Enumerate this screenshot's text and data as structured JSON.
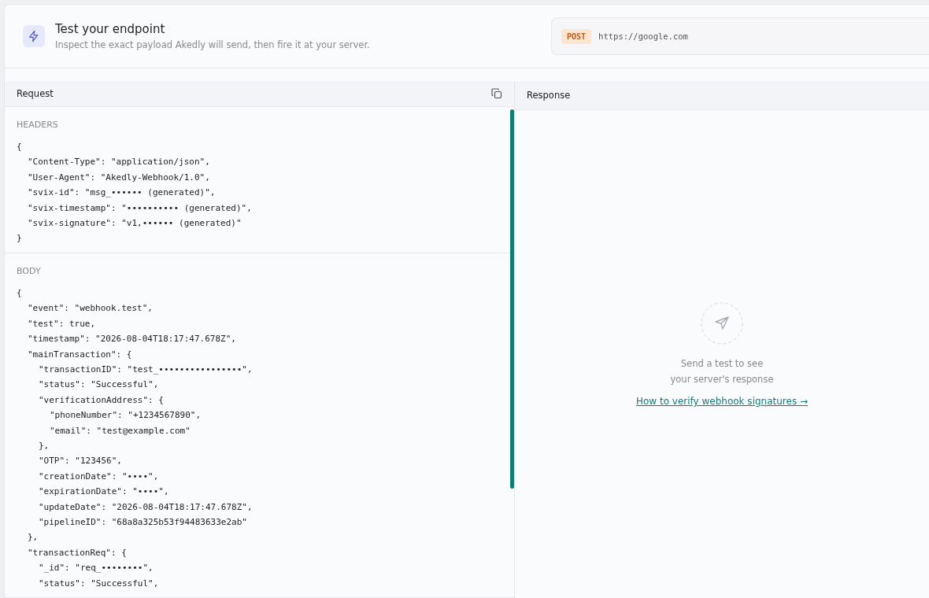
{
  "dialog": {
    "title": "Test your endpoint",
    "subtitle": "Inspect the exact payload Akedly will send, then fire it at your server.",
    "method": "POST",
    "url": "https://google.com"
  },
  "request": {
    "title": "Request",
    "sections": [
      {
        "label": "HEADERS",
        "lines": [
          {
            "text": "{",
            "children": [
              {
                "text": "\"Content-Type\": \"application/json\","
              },
              {
                "text": "\"User-Agent\": \"Akedly-Webhook/1.0\","
              },
              {
                "text": "\"svix-id\": \"msg_•••••• (generated)\","
              },
              {
                "text": "\"svix-timestamp\": \"•••••••••• (generated)\","
              },
              {
                "text": "\"svix-signature\": \"v1,•••••• (generated)\""
              }
            ]
          },
          {
            "text": "}"
          }
        ]
      },
      {
        "label": "BODY",
        "lines": [
          {
            "text": "{",
            "children": [
              {
                "text": "\"event\": \"webhook.test\","
              },
              {
                "text": "\"test\": true,"
              },
              {
                "text": "\"timestamp\": \"2026-08-04T18:17:47.678Z\","
              },
              {
                "text": "\"mainTransaction\": {",
                "children": [
                  {
                    "text": "\"transactionID\": \"test_••••••••••••••••\","
                  },
                  {
                    "text": "\"status\": \"Successful\","
                  },
                  {
                    "text": "\"verificationAddress\": {",
                    "children": [
                      {
                        "text": "\"phoneNumber\": \"+1234567890\","
                      },
                      {
                        "text": "\"email\": \"test@example.com\""
                      }
                    ]
                  },
                  {
                    "text": "},"
                  },
                  {
                    "text": "\"OTP\": \"123456\","
                  },
                  {
                    "text": "\"creationDate\": \"••••\","
                  },
                  {
                    "text": "\"expirationDate\": \"••••\","
                  },
                  {
                    "text": "\"updateDate\": \"2026-08-04T18:17:47.678Z\","
                  },
                  {
                    "text": "\"pipelineID\": \"68a8a325b53f94483633e2ab\""
                  }
                ]
              },
              {
                "text": "},"
              },
              {
                "text": "\"transactionReq\": {",
                "children": [
                  {
                    "text": "\"_id\": \"req_••••••••\","
                  },
                  {
                    "text": "\"status\": \"Successful\","
                  }
                ]
              }
            ]
          }
        ]
      }
    ]
  },
  "response": {
    "title": "Response",
    "empty_line_1": "Send a test to see",
    "empty_line_2": "your server's response",
    "link": "How to verify webhook signatures →"
  }
}
